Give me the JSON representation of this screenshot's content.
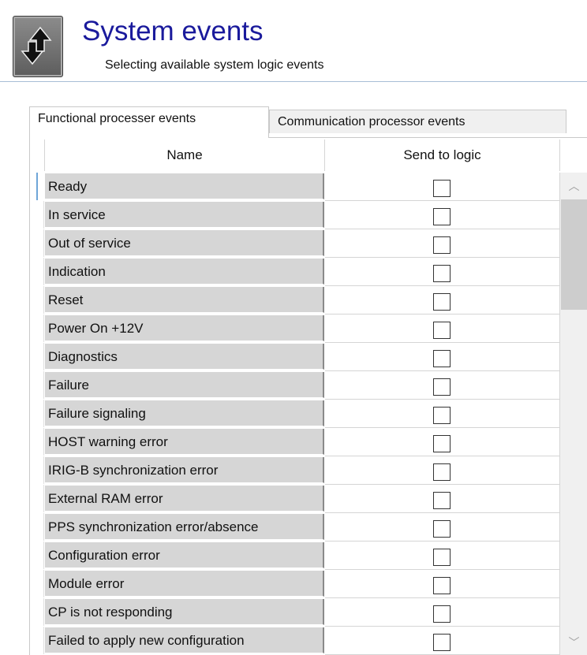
{
  "header": {
    "title": "System events",
    "subtitle": "Selecting available system logic events"
  },
  "tabs": [
    {
      "label": "Functional processer events",
      "active": true
    },
    {
      "label": "Communication processor events",
      "active": false
    }
  ],
  "table": {
    "columns": [
      "Name",
      "Send to logic"
    ],
    "rows": [
      {
        "name": "Ready",
        "send": false
      },
      {
        "name": "In service",
        "send": false
      },
      {
        "name": "Out of service",
        "send": false
      },
      {
        "name": "Indication",
        "send": false
      },
      {
        "name": "Reset",
        "send": false
      },
      {
        "name": "Power On +12V",
        "send": false
      },
      {
        "name": "Diagnostics",
        "send": false
      },
      {
        "name": "Failure",
        "send": false
      },
      {
        "name": "Failure signaling",
        "send": false
      },
      {
        "name": "HOST warning error",
        "send": false
      },
      {
        "name": "IRIG-B synchronization error",
        "send": false
      },
      {
        "name": "External RAM error",
        "send": false
      },
      {
        "name": "PPS synchronization error/absence",
        "send": false
      },
      {
        "name": "Configuration error",
        "send": false
      },
      {
        "name": "Module error",
        "send": false
      },
      {
        "name": "CP is not responding",
        "send": false
      },
      {
        "name": "Failed to apply new configuration",
        "send": false
      }
    ]
  },
  "icons": {
    "app": "up-down-arrows-icon",
    "scroll_up": "chevron-up-icon",
    "scroll_down": "chevron-down-icon"
  },
  "colors": {
    "title": "#1a1a9c",
    "name_cell_bg": "#d6d6d6",
    "current_row_marker": "#6fa6d8"
  }
}
